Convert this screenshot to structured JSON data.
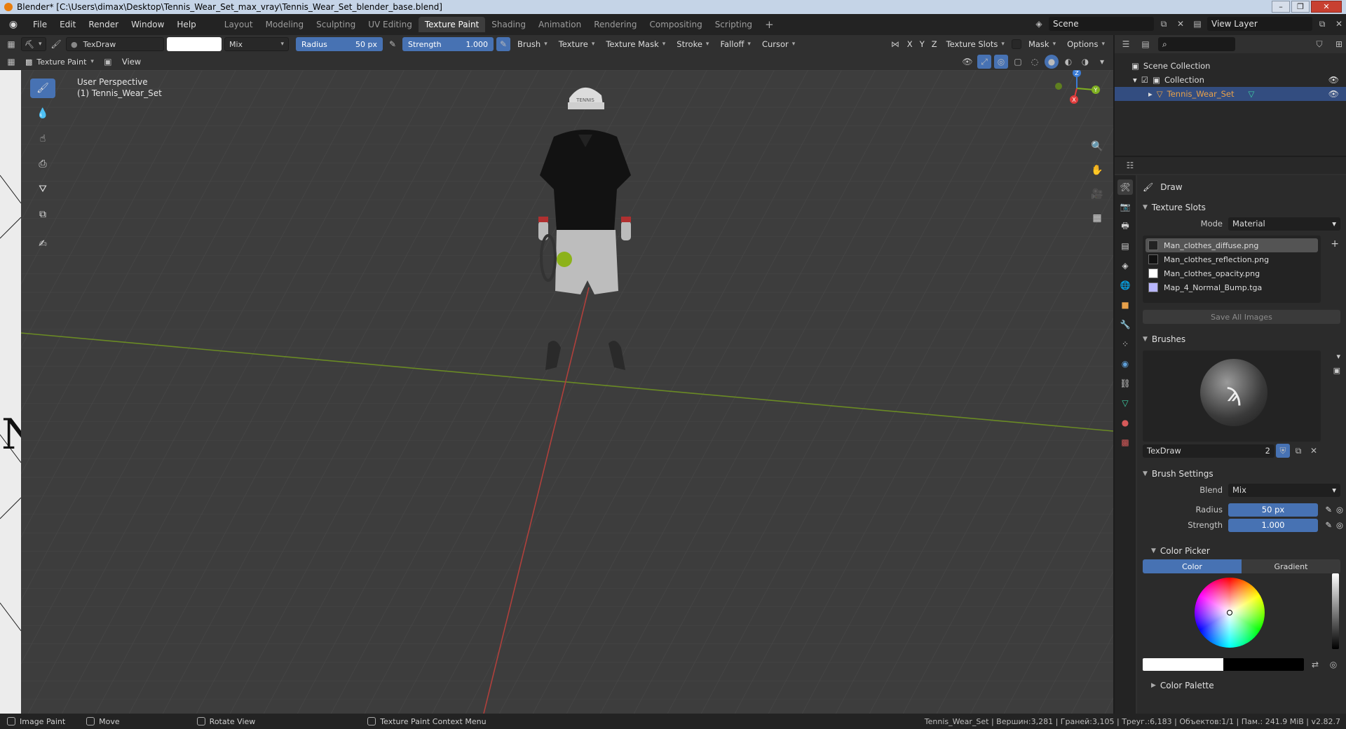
{
  "window": {
    "title": "Blender* [C:\\Users\\dimax\\Desktop\\Tennis_Wear_Set_max_vray\\Tennis_Wear_Set_blender_base.blend]"
  },
  "menu": [
    "File",
    "Edit",
    "Render",
    "Window",
    "Help"
  ],
  "workspaces": [
    "Layout",
    "Modeling",
    "Sculpting",
    "UV Editing",
    "Texture Paint",
    "Shading",
    "Animation",
    "Rendering",
    "Compositing",
    "Scripting"
  ],
  "active_workspace": "Texture Paint",
  "scene": {
    "name": "Scene",
    "view_layer": "View Layer"
  },
  "toolsettings": {
    "brush_name": "TexDraw",
    "blend": "Mix",
    "radius_label": "Radius",
    "radius_value": "50 px",
    "strength_label": "Strength",
    "strength_value": "1.000",
    "menus": [
      "Brush",
      "Texture",
      "Texture Mask",
      "Stroke",
      "Falloff",
      "Cursor"
    ],
    "right": {
      "x": "X",
      "y": "Y",
      "z": "Z",
      "texture_slots": "Texture Slots",
      "mask": "Mask",
      "options": "Options"
    }
  },
  "header2": {
    "mode": "Texture Paint",
    "view": "View"
  },
  "viewport": {
    "perspective": "User Perspective",
    "object": "(1) Tennis_Wear_Set",
    "cap_text": "TENNIS"
  },
  "gizmo": {
    "x": "X",
    "y": "Y",
    "z": "Z"
  },
  "outliner": {
    "root": "Scene Collection",
    "collection": "Collection",
    "object": "Tennis_Wear_Set"
  },
  "properties": {
    "tool_name": "Draw",
    "texture_slots": {
      "section": "Texture Slots",
      "mode_label": "Mode",
      "mode_value": "Material",
      "slots": [
        "Man_clothes_diffuse.png",
        "Man_clothes_reflection.png",
        "Man_clothes_opacity.png",
        "Map_4_Normal_Bump.tga"
      ],
      "save_all": "Save All Images"
    },
    "brushes": {
      "section": "Brushes",
      "name": "TexDraw",
      "users": "2"
    },
    "brush_settings": {
      "section": "Brush Settings",
      "blend_label": "Blend",
      "blend_value": "Mix",
      "radius_label": "Radius",
      "radius_value": "50 px",
      "strength_label": "Strength",
      "strength_value": "1.000"
    },
    "color_picker": {
      "section": "Color Picker",
      "tab_color": "Color",
      "tab_gradient": "Gradient"
    },
    "color_palette": {
      "section": "Color Palette"
    }
  },
  "statusbar": {
    "items": [
      "Image Paint",
      "Move",
      "Rotate View",
      "Texture Paint Context Menu"
    ],
    "stats": "Tennis_Wear_Set | Вершин:3,281 | Граней:3,105 | Треуг.:6,183 | Объектов:1/1 | Пам.: 241.9 MiB | v2.82.7"
  },
  "colors": {
    "accent": "#4772b3",
    "axis_x": "#e03c3c",
    "axis_y": "#7fb021",
    "axis_z": "#3b7dd8"
  }
}
